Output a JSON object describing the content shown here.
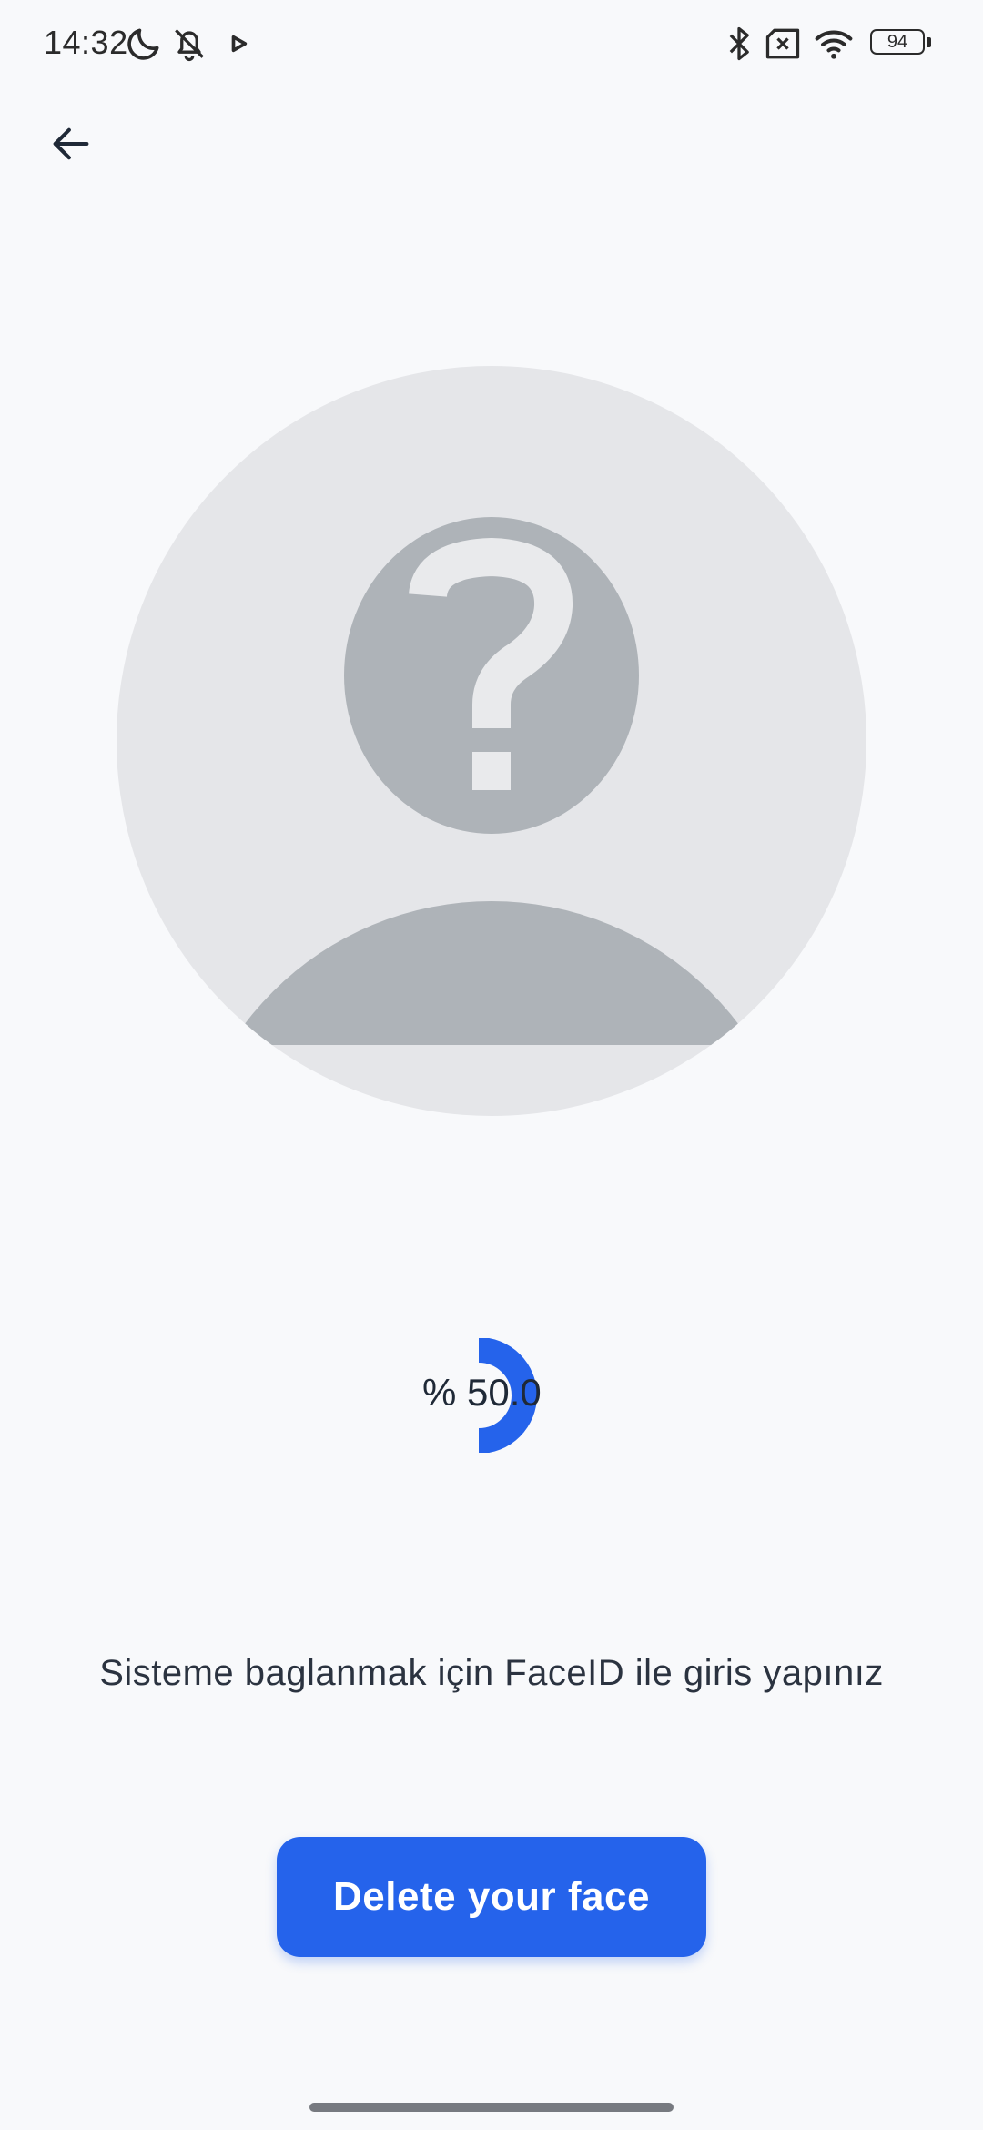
{
  "status_bar": {
    "time": "14:32",
    "icons_left": [
      "moon-icon",
      "bell-off-icon",
      "play-icon"
    ],
    "icons_right": [
      "bluetooth-icon",
      "no-sim-icon",
      "wifi-icon",
      "battery-icon"
    ],
    "battery_level": "94"
  },
  "header": {
    "back_icon": "arrow-left-icon"
  },
  "avatar": {
    "icon": "unknown-person-icon"
  },
  "progress": {
    "label": "% 50.0",
    "value": 0.5,
    "color": "#2563eb"
  },
  "instruction": {
    "text": "Sisteme baglanmak için FaceID ile giris yapınız"
  },
  "actions": {
    "delete_label": "Delete your face",
    "primary_color": "#2563eb"
  }
}
